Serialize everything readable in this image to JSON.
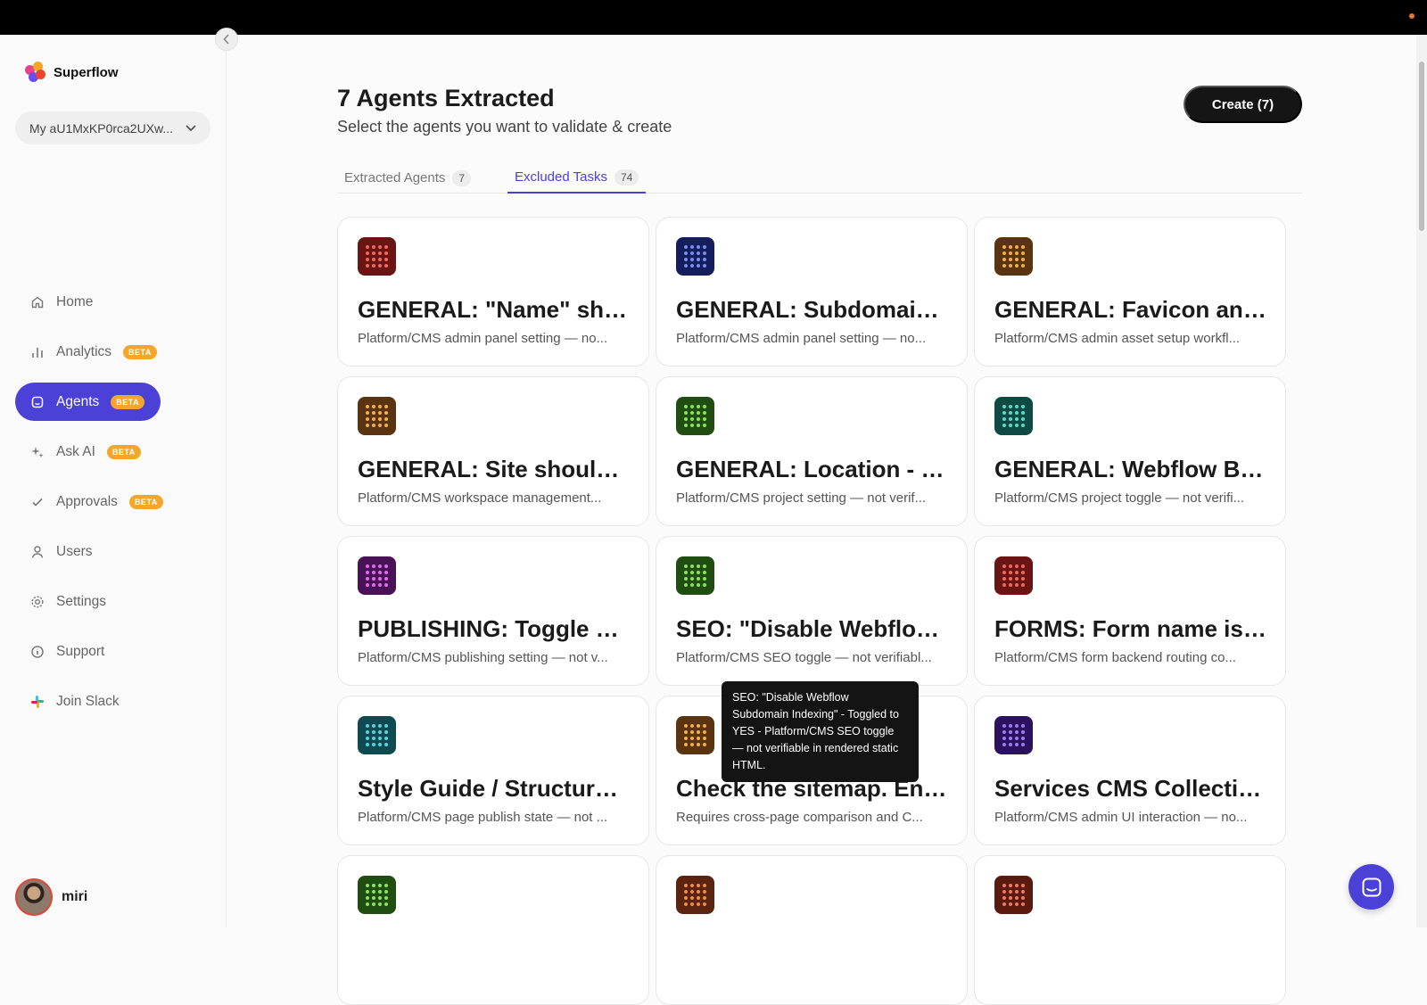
{
  "brand": {
    "name": "Superflow"
  },
  "workspace": {
    "label": "My aU1MxKP0rca2UXw..."
  },
  "nav": {
    "items": [
      {
        "label": "Home",
        "icon": "home-icon",
        "badge": ""
      },
      {
        "label": "Analytics",
        "icon": "bar-chart-icon",
        "badge": "BETA"
      },
      {
        "label": "Agents",
        "icon": "agent-icon",
        "badge": "BETA",
        "active": true
      },
      {
        "label": "Ask AI",
        "icon": "sparkle-icon",
        "badge": "BETA"
      },
      {
        "label": "Approvals",
        "icon": "check-icon",
        "badge": "BETA"
      },
      {
        "label": "Users",
        "icon": "user-icon",
        "badge": ""
      },
      {
        "label": "Settings",
        "icon": "gear-icon",
        "badge": ""
      },
      {
        "label": "Support",
        "icon": "info-icon",
        "badge": ""
      },
      {
        "label": "Join Slack",
        "icon": "slack-icon",
        "badge": ""
      }
    ]
  },
  "user": {
    "name": "miri"
  },
  "header": {
    "title": "7 Agents Extracted",
    "subtitle": "Select the agents you want to validate & create",
    "create_label": "Create (7)"
  },
  "tabs": [
    {
      "label": "Extracted Agents",
      "count": "7"
    },
    {
      "label": "Excluded Tasks",
      "count": "74",
      "active": true
    }
  ],
  "cards": [
    {
      "title": "GENERAL: \"Name\" shoul...",
      "desc": "Platform/CMS admin panel setting — no...",
      "bg": "#6b1414",
      "dot": "#f06a5a"
    },
    {
      "title": "GENERAL: Subdomain s...",
      "desc": "Platform/CMS admin panel setting — no...",
      "bg": "#141e5c",
      "dot": "#7b8cf0"
    },
    {
      "title": "GENERAL: Favicon and ...",
      "desc": "Platform/CMS admin asset setup workfl...",
      "bg": "#5a3410",
      "dot": "#f0b04a"
    },
    {
      "title": "GENERAL: Site should b...",
      "desc": "Platform/CMS workspace management...",
      "bg": "#5a3410",
      "dot": "#f0b04a"
    },
    {
      "title": "GENERAL: Location - Set...",
      "desc": "Platform/CMS project setting — not verif...",
      "bg": "#1f4d12",
      "dot": "#8ee05a"
    },
    {
      "title": "GENERAL: Webflow Bran...",
      "desc": "Platform/CMS project toggle — not verifi...",
      "bg": "#0e4a44",
      "dot": "#5ad8c8"
    },
    {
      "title": "PUBLISHING: Toggle all \"...",
      "desc": "Platform/CMS publishing setting — not v...",
      "bg": "#4a1256",
      "dot": "#e06af0"
    },
    {
      "title": "SEO: \"Disable Webflow ...",
      "desc": "Platform/CMS SEO toggle — not verifiabl...",
      "bg": "#1f4d12",
      "dot": "#8ee05a"
    },
    {
      "title": "FORMS: Form name is s...",
      "desc": "Platform/CMS form backend routing co...",
      "bg": "#6b1414",
      "dot": "#f06a5a"
    },
    {
      "title": "Style Guide / Structure ...",
      "desc": "Platform/CMS page publish state — not ...",
      "bg": "#0e4a50",
      "dot": "#5ad0e0"
    },
    {
      "title": "Check the sitemap. Ens...",
      "desc": "Requires cross-page comparison and C...",
      "bg": "#5a3410",
      "dot": "#f0b04a"
    },
    {
      "title": "Services CMS Collectio...",
      "desc": "Platform/CMS admin UI interaction — no...",
      "bg": "#2a1260",
      "dot": "#a07af0"
    },
    {
      "title": "",
      "desc": "",
      "bg": "#1f4d12",
      "dot": "#8ee05a"
    },
    {
      "title": "",
      "desc": "",
      "bg": "#5a2410",
      "dot": "#f08a4a"
    },
    {
      "title": "",
      "desc": "",
      "bg": "#5a1a10",
      "dot": "#f07a5a"
    }
  ],
  "tooltip": {
    "text": "SEO: \"Disable Webflow Subdomain Indexing\" - Toggled to YES - Platform/CMS SEO toggle — not verifiable in rendered static HTML."
  },
  "colors": {
    "accent": "#4b41d6",
    "beta": "#f4a62a",
    "dark_button": "#151515"
  }
}
